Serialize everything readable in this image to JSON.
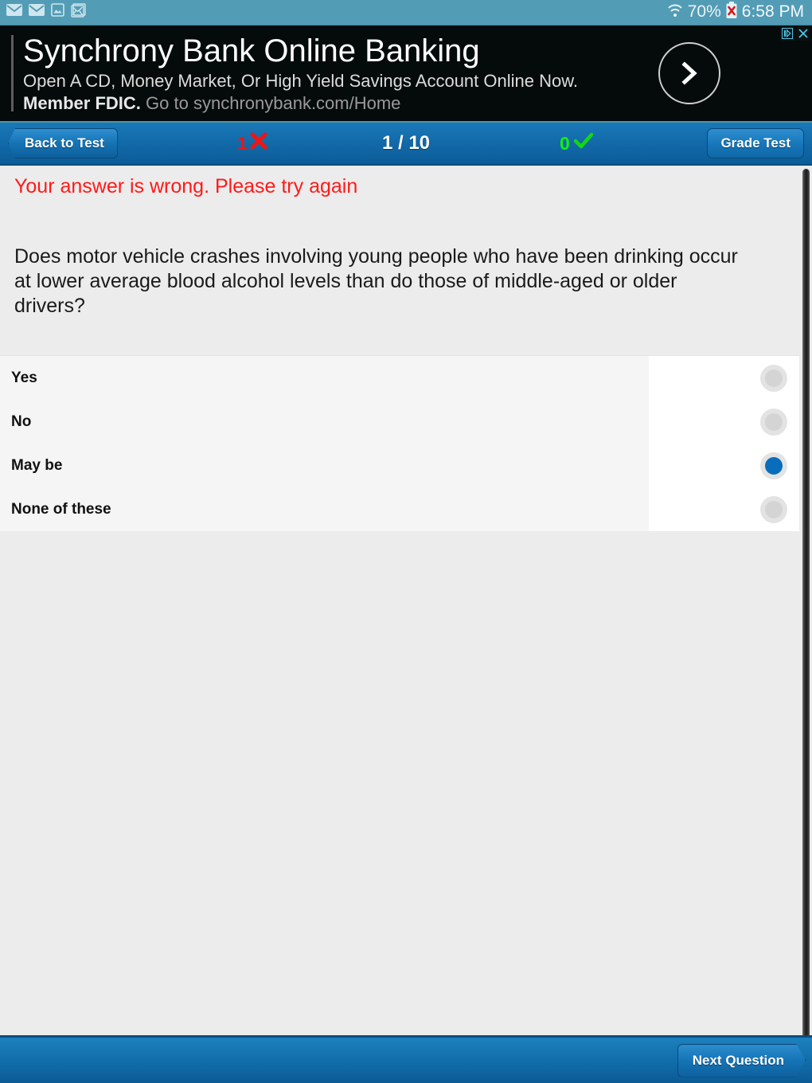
{
  "status_bar": {
    "icons": [
      "email-icon",
      "email-icon",
      "photo-icon",
      "gmail-icon"
    ],
    "wifi_icon": "wifi-icon",
    "battery_percent": "70%",
    "battery_icon": "battery-error-icon",
    "clock": "6:58 PM"
  },
  "ad": {
    "headline": "Synchrony Bank Online Banking",
    "line2": "Open A CD, Money Market, Or High Yield Savings Account Online Now.",
    "line3_bold": "Member FDIC.",
    "line3_dim": "Go to synchronybank.com/Home",
    "cta_icon": "chevron-right-circle-icon",
    "adchoices_icon": "adchoices-icon",
    "close_icon": "close-icon"
  },
  "toolbar": {
    "back_label": "Back to Test",
    "wrong_count": "1",
    "wrong_icon": "cross-mark-icon",
    "question_counter": "1 / 10",
    "correct_count": "0",
    "correct_icon": "check-mark-icon",
    "grade_label": "Grade Test",
    "wrong_color": "#f01414",
    "correct_color": "#12f012"
  },
  "quiz": {
    "feedback": "Your answer is wrong. Please try again",
    "feedback_color": "#ff1a1a",
    "question": "Does motor vehicle crashes involving young people who have been drinking occur at lower average blood alcohol levels than do those of middle-aged or older drivers?",
    "options": [
      {
        "label": "Yes",
        "selected": false
      },
      {
        "label": "No",
        "selected": false
      },
      {
        "label": "May be",
        "selected": true
      },
      {
        "label": "None of these",
        "selected": false
      }
    ],
    "selected_color": "#0a6dbb"
  },
  "bottom_bar": {
    "next_label": "Next Question"
  }
}
